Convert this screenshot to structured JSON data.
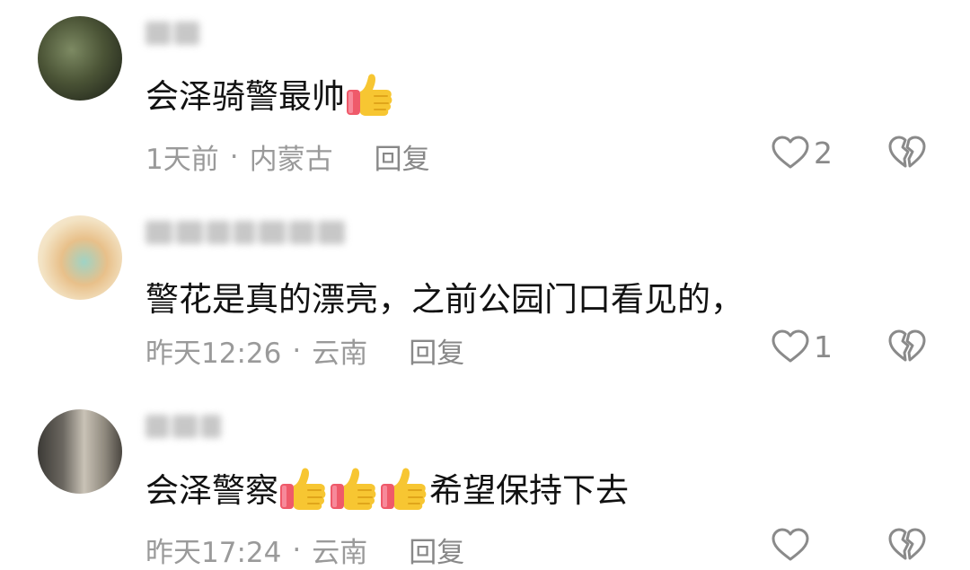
{
  "comments": [
    {
      "content_text": "会泽骑警最帅",
      "thumbs_after": 1,
      "content_suffix": "",
      "time": "1天前",
      "separator": "·",
      "location": "内蒙古",
      "reply_label": "回复",
      "like_count": "2"
    },
    {
      "content_text": "警花是真的漂亮，之前公园门口看见的，",
      "thumbs_after": 0,
      "content_suffix": "",
      "time": "昨天12:26",
      "separator": "·",
      "location": "云南",
      "reply_label": "回复",
      "like_count": "1"
    },
    {
      "content_text": "会泽警察",
      "thumbs_after": 3,
      "content_suffix": "希望保持下去",
      "time": "昨天17:24",
      "separator": "·",
      "location": "云南",
      "reply_label": "回复",
      "like_count": ""
    }
  ],
  "icons": {
    "like": "heart-outline-icon",
    "dislike": "broken-heart-icon",
    "emoji": "thumbs-up-emoji"
  },
  "colors": {
    "text": "#111111",
    "meta": "#9a9a9a",
    "icon": "#8a8a8a",
    "thumb": "#f7c632",
    "cuff": "#ef5a6a"
  }
}
